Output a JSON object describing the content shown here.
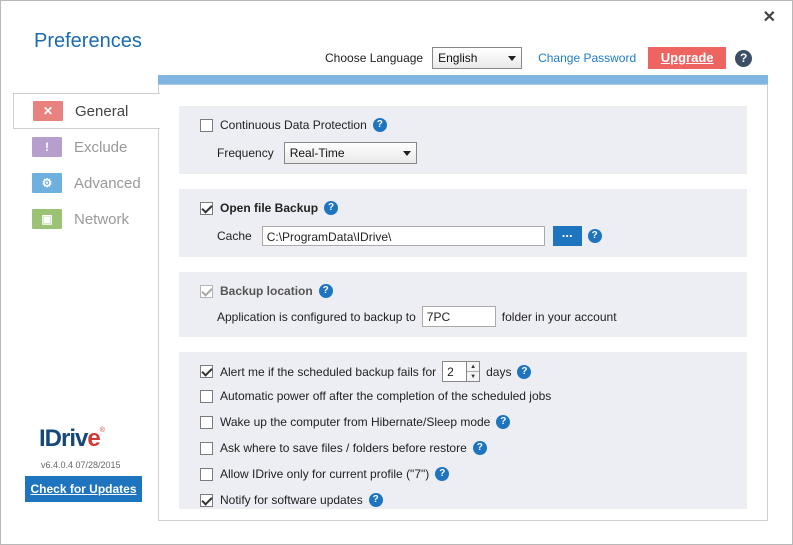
{
  "window": {
    "title": "Preferences",
    "close_glyph": "✕"
  },
  "header": {
    "language_label": "Choose Language",
    "language_value": "English",
    "change_password": "Change Password",
    "upgrade": "Upgrade",
    "help_glyph": "?"
  },
  "sidebar": {
    "items": [
      {
        "label": "General",
        "icon": "tools-icon",
        "glyph": "✕",
        "color": "#e8827f",
        "active": true
      },
      {
        "label": "Exclude",
        "icon": "exclamation-icon",
        "glyph": "!",
        "color": "#b69fcc",
        "active": false
      },
      {
        "label": "Advanced",
        "icon": "gear-icon",
        "glyph": "⚙",
        "color": "#6fb1de",
        "active": false
      },
      {
        "label": "Network",
        "icon": "network-icon",
        "glyph": "▣",
        "color": "#9bc275",
        "active": false
      }
    ]
  },
  "cdp": {
    "label": "Continuous Data Protection",
    "checked": false,
    "frequency_label": "Frequency",
    "frequency_value": "Real-Time"
  },
  "open_file_backup": {
    "label": "Open file Backup",
    "checked": true,
    "cache_label": "Cache",
    "cache_value": "C:\\ProgramData\\IDrive\\",
    "browse_label": "..."
  },
  "backup_location": {
    "label": "Backup location",
    "checked": true,
    "disabled": true,
    "text_before": "Application is configured to backup to",
    "folder_value": "7PC",
    "text_after": "folder in your account"
  },
  "options": {
    "alert": {
      "label": "Alert me if the scheduled backup fails for",
      "checked": true,
      "days_value": "2",
      "days_label": "days"
    },
    "power_off": {
      "label": "Automatic power off after the completion of the scheduled jobs",
      "checked": false
    },
    "wake_up": {
      "label": "Wake up the computer from Hibernate/Sleep mode",
      "checked": false
    },
    "ask_where": {
      "label": "Ask where to save files / folders before restore",
      "checked": false
    },
    "allow_profile": {
      "label": "Allow IDrive only for current profile (\"7\")",
      "checked": false
    },
    "notify": {
      "label": "Notify for software updates",
      "checked": true
    }
  },
  "footer": {
    "logo_main": "IDriv",
    "logo_e": "e",
    "logo_reg": "®",
    "version": "v6.4.0.4  07/28/2015",
    "check_updates": "Check for Updates"
  },
  "colors": {
    "accent": "#1e74bf",
    "upgrade": "#ee6461",
    "title": "#1a6bb0",
    "section_bg": "#edeef3",
    "panel_top": "#7fb5e0"
  }
}
